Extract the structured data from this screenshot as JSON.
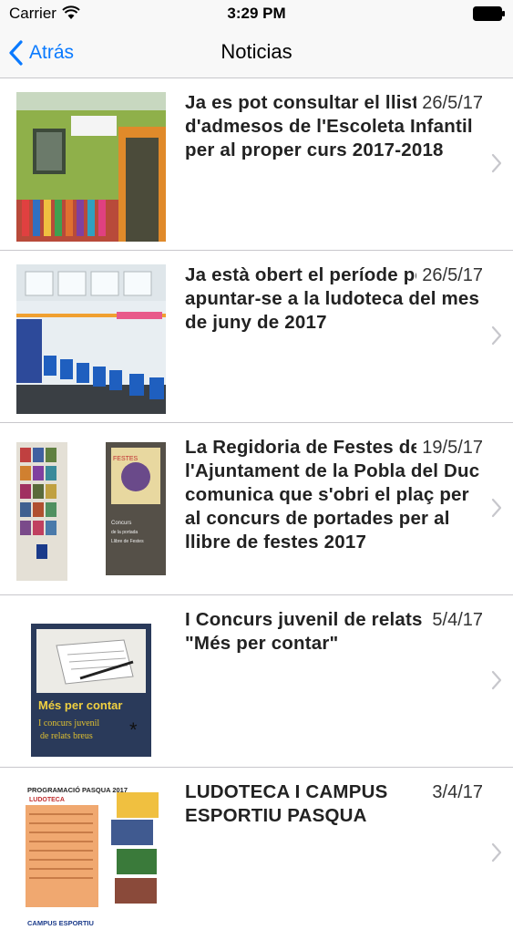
{
  "status_bar": {
    "carrier": "Carrier",
    "time": "3:29 PM"
  },
  "nav": {
    "back_label": "Atrás",
    "title": "Noticias"
  },
  "news": [
    {
      "title": "Ja es pot consultar el llistat d'admesos de l'Escoleta Infantil per al proper curs 2017-2018",
      "date": "26/5/17",
      "thumb_text": ""
    },
    {
      "title": "Ja està obert el període per apuntar-se a la ludoteca del mes de juny de 2017",
      "date": "26/5/17",
      "thumb_text": ""
    },
    {
      "title": "La Regidoria de Festes de l'Ajuntament de la Pobla del Duc comunica que s'obri el plaç per al concurs de portades per al llibre de festes 2017",
      "date": "19/5/17",
      "thumb_text": "Concurs de la portada del Llibre de Festes"
    },
    {
      "title": "I Concurs juvenil de relats breus \"Més per contar\"",
      "date": "5/4/17",
      "thumb_text": "Més per contar"
    },
    {
      "title": "LUDOTECA I CAMPUS ESPORTIU PASQUA",
      "date": "3/4/17",
      "thumb_text": "PROGRAMACIÓ PASQUA 2017"
    }
  ],
  "colors": {
    "accent": "#0a7aff",
    "separator": "#c8c7cc",
    "bar_bg": "#f8f8f8"
  }
}
